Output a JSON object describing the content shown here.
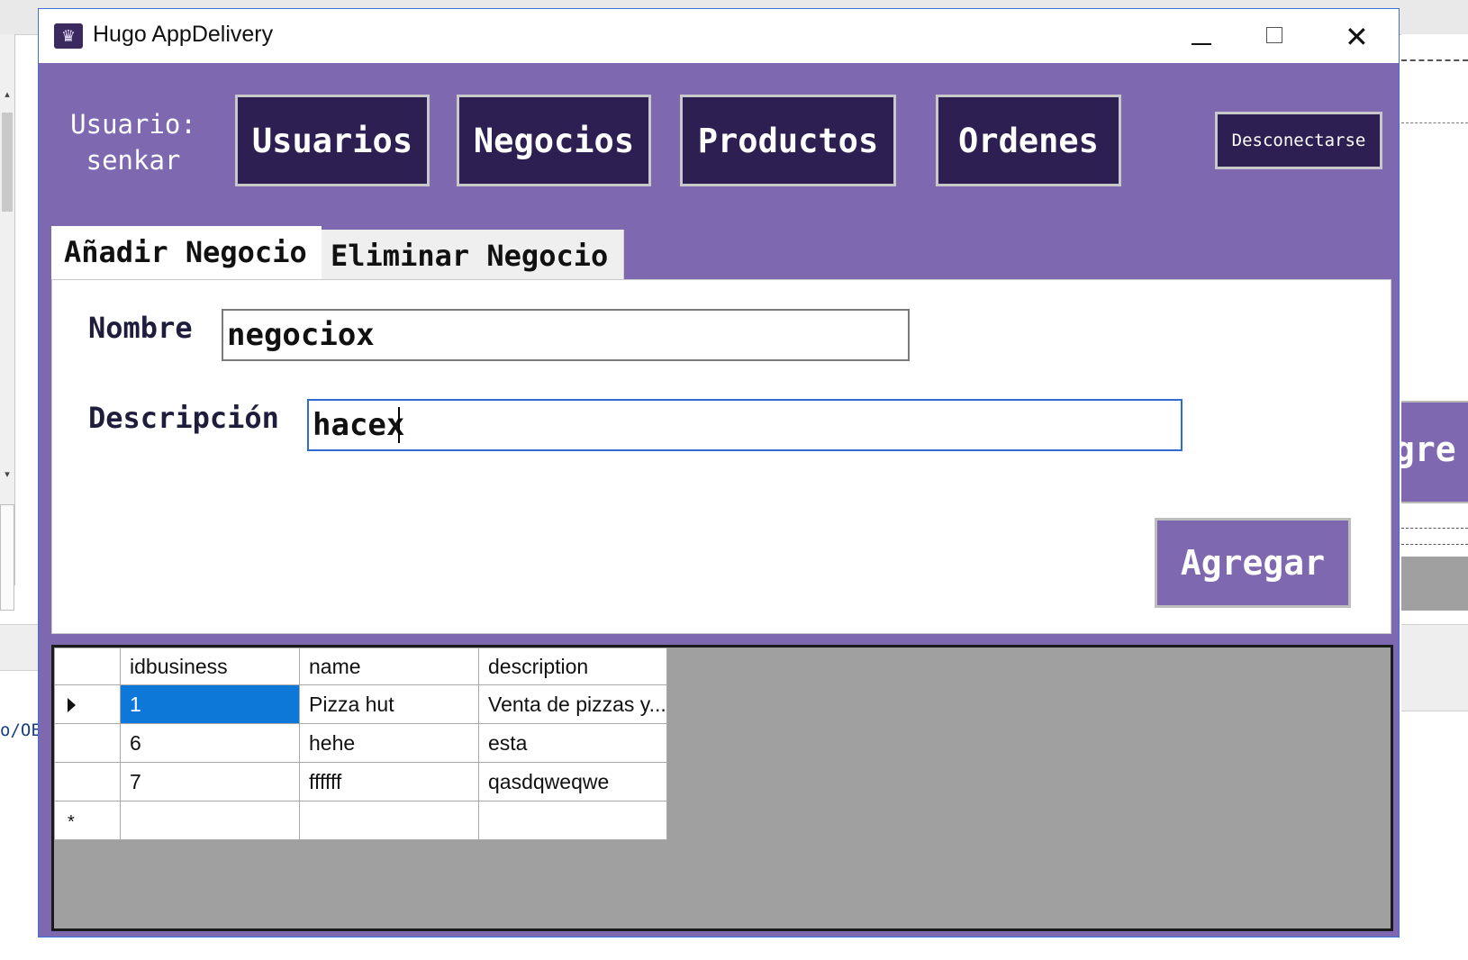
{
  "window": {
    "title": "Hugo AppDelivery",
    "controls": {
      "minimize_icon": "minimize-icon",
      "maximize_icon": "maximize-icon",
      "close_icon": "close-icon"
    }
  },
  "header": {
    "user_label": "Usuario:",
    "user_name": "senkar",
    "nav": [
      "Usuarios",
      "Negocios",
      "Productos",
      "Ordenes"
    ],
    "logout": "Desconectarse"
  },
  "tabs": [
    {
      "label": "Añadir Negocio",
      "active": true
    },
    {
      "label": "Eliminar Negocio",
      "active": false
    }
  ],
  "form": {
    "nombre_label": "Nombre",
    "nombre_value": "negociox",
    "descripcion_label": "Descripción",
    "descripcion_value": "hacex",
    "submit": "Agregar"
  },
  "grid": {
    "columns": [
      "idbusiness",
      "name",
      "description"
    ],
    "rows": [
      {
        "idbusiness": "1",
        "name": "Pizza hut",
        "description": "Venta de pizzas y...",
        "current": true
      },
      {
        "idbusiness": "6",
        "name": "hehe",
        "description": "esta",
        "current": false
      },
      {
        "idbusiness": "7",
        "name": "ffffff",
        "description": "qasdqweqwe",
        "current": false
      }
    ],
    "new_row_marker": "*"
  },
  "background": {
    "left_text": "o/OE",
    "right_button_fragment": "gre"
  },
  "colors": {
    "accent": "#7e68b0",
    "nav_button": "#2e1f52",
    "selection": "#0d78d8",
    "grid_background": "#a0a0a0"
  }
}
